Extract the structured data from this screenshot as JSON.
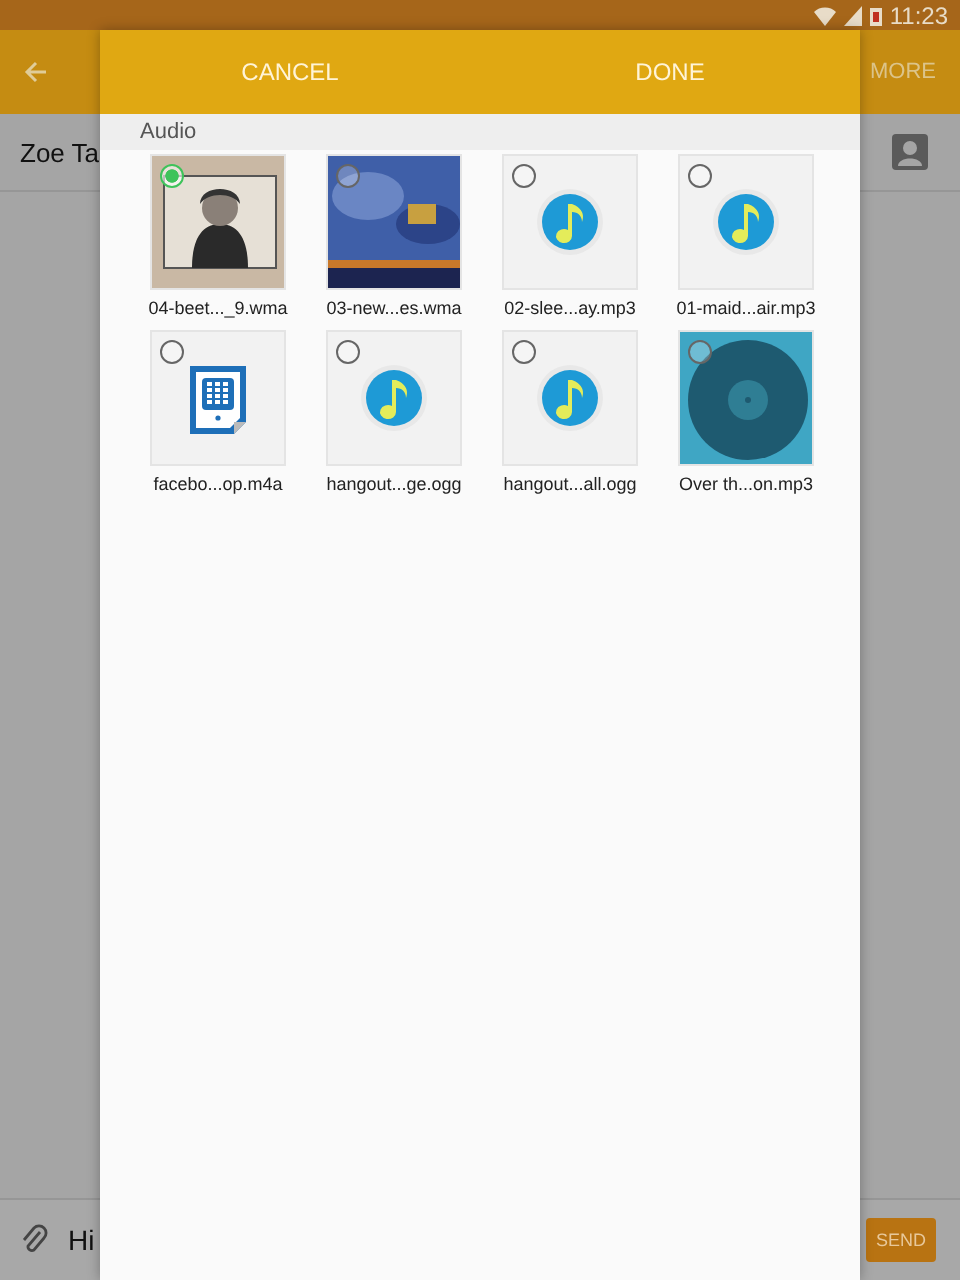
{
  "status_bar": {
    "time": "11:23"
  },
  "app_bar": {
    "action": "MORE"
  },
  "contact": {
    "name": "Zoe Ta"
  },
  "composer": {
    "message": "Hi",
    "send": "SEND"
  },
  "dialog": {
    "cancel": "CANCEL",
    "done": "DONE",
    "section": "Audio",
    "files": [
      {
        "name": "04-beet..._9.wma",
        "kind": "picture",
        "selected": true
      },
      {
        "name": "03-new...es.wma",
        "kind": "picture",
        "selected": false
      },
      {
        "name": "02-slee...ay.mp3",
        "kind": "music",
        "selected": false
      },
      {
        "name": "01-maid...air.mp3",
        "kind": "music",
        "selected": false
      },
      {
        "name": "facebo...op.m4a",
        "kind": "document",
        "selected": false
      },
      {
        "name": "hangout...ge.ogg",
        "kind": "music",
        "selected": false
      },
      {
        "name": "hangout...all.ogg",
        "kind": "music",
        "selected": false
      },
      {
        "name": "Over th...on.mp3",
        "kind": "picture",
        "selected": false
      }
    ]
  }
}
